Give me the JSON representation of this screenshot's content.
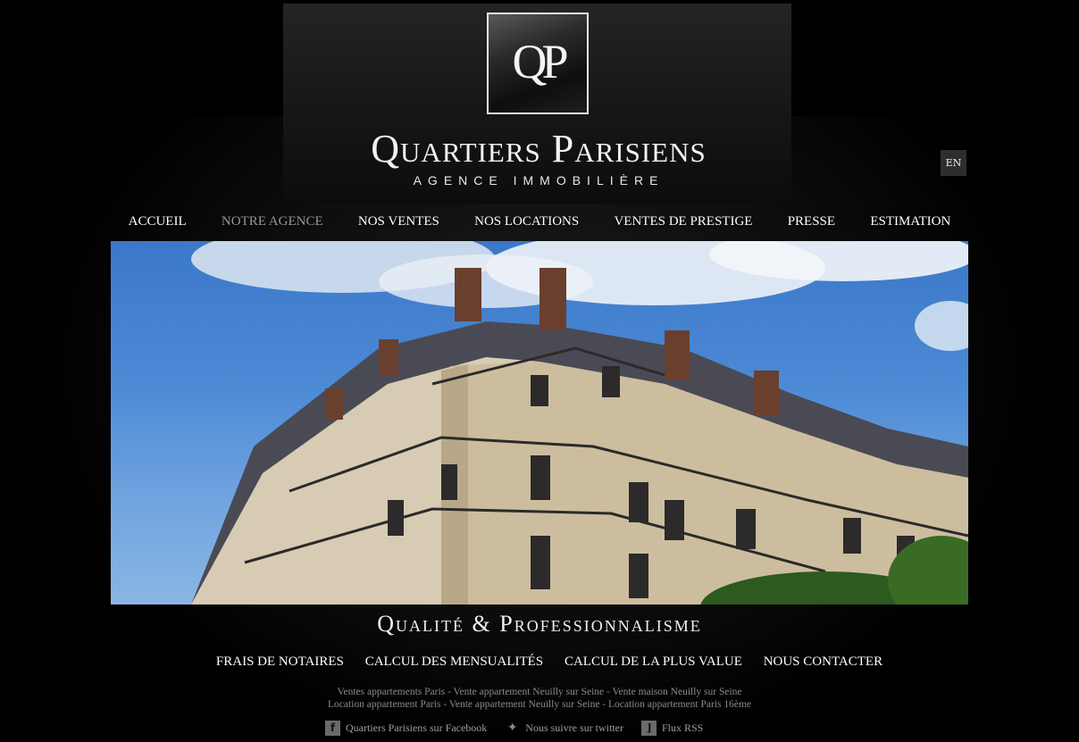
{
  "brand": {
    "logo_letters": "QP",
    "name": "Quartiers Parisiens",
    "tagline": "AGENCE IMMOBILIÈRE"
  },
  "language_toggle": "EN",
  "nav": {
    "items": [
      {
        "label": "ACCUEIL"
      },
      {
        "label": "NOTRE AGENCE"
      },
      {
        "label": "NOS VENTES"
      },
      {
        "label": "NOS LOCATIONS"
      },
      {
        "label": "VENTES DE PRESTIGE"
      },
      {
        "label": "PRESSE"
      },
      {
        "label": "ESTIMATION"
      }
    ]
  },
  "hero": {
    "alt": "Parisian Haussmann building against blue sky"
  },
  "slogan": "Qualité & Professionnalisme",
  "subnav": {
    "items": [
      {
        "label": "FRAIS DE NOTAIRES"
      },
      {
        "label": "CALCUL DES MENSUALITÉS"
      },
      {
        "label": "CALCUL DE LA PLUS VALUE"
      },
      {
        "label": "NOUS CONTACTER"
      }
    ]
  },
  "seo_links": {
    "line1": [
      "Ventes appartements Paris",
      "Vente appartement Neuilly sur Seine",
      "Vente maison Neuilly sur Seine"
    ],
    "line2": [
      "Location appartement Paris",
      "Vente appartement Neuilly sur Seine",
      "Location appartement Paris 16ème"
    ],
    "separator": " - "
  },
  "social": {
    "facebook": {
      "label": "Quartiers Parisiens sur Facebook",
      "icon": "facebook-icon"
    },
    "twitter": {
      "label": "Nous suivre sur twitter",
      "icon": "twitter-bird-icon"
    },
    "rss": {
      "label": "Flux RSS",
      "icon": "rss-icon"
    }
  },
  "colors": {
    "background": "#000000",
    "nav_active": "#9a9a9a",
    "text": "#ffffff",
    "footer_text": "#8a8a8a"
  }
}
